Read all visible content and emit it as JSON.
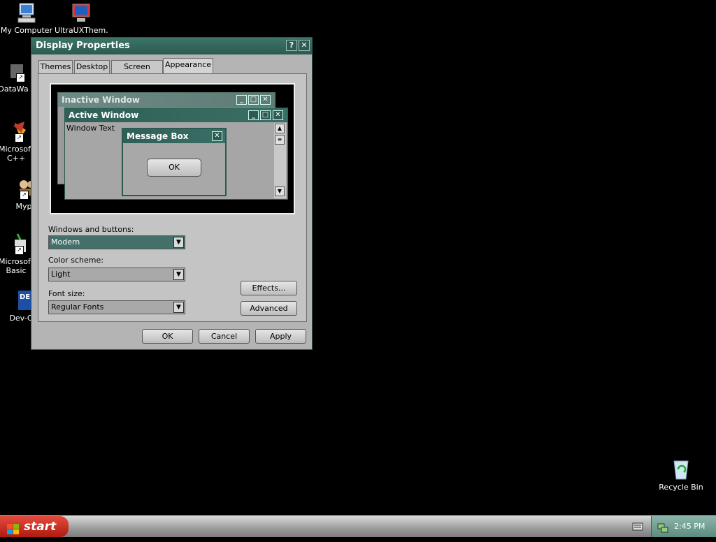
{
  "desktop": {
    "icons": [
      {
        "label": "My Computer"
      },
      {
        "label": "UltraUXThem..."
      },
      {
        "label": "DataWa"
      },
      {
        "label": "Microsoft\nC++"
      },
      {
        "label": "Myp"
      },
      {
        "label": "Microsoft\nBasic"
      },
      {
        "label": "Dev-C"
      },
      {
        "label": "Recycle Bin"
      }
    ]
  },
  "dialog": {
    "title": "Display Properties",
    "help_glyph": "?",
    "close_glyph": "✕",
    "tabs": [
      {
        "label": "Themes"
      },
      {
        "label": "Desktop"
      },
      {
        "label": "Screen Saver"
      },
      {
        "label": "Appearance"
      }
    ],
    "preview": {
      "inactive_title": "Inactive Window",
      "active_title": "Active Window",
      "window_text": "Window Text",
      "message_box_title": "Message Box",
      "message_box_ok": "OK"
    },
    "windows_buttons_label": "Windows and buttons:",
    "windows_buttons_value": "Modern",
    "color_scheme_label": "Color scheme:",
    "color_scheme_value": "Light",
    "font_size_label": "Font size:",
    "font_size_value": "Regular Fonts",
    "effects_button": "Effects...",
    "advanced_button": "Advanced",
    "ok_button": "OK",
    "cancel_button": "Cancel",
    "apply_button": "Apply"
  },
  "taskbar": {
    "start_label": "start",
    "clock": "2:45 PM"
  },
  "colors": {
    "title_bar": "#2c5a52",
    "desktop": "#000000",
    "start_button": "#c9241a",
    "selected_combo": "#44706a"
  }
}
